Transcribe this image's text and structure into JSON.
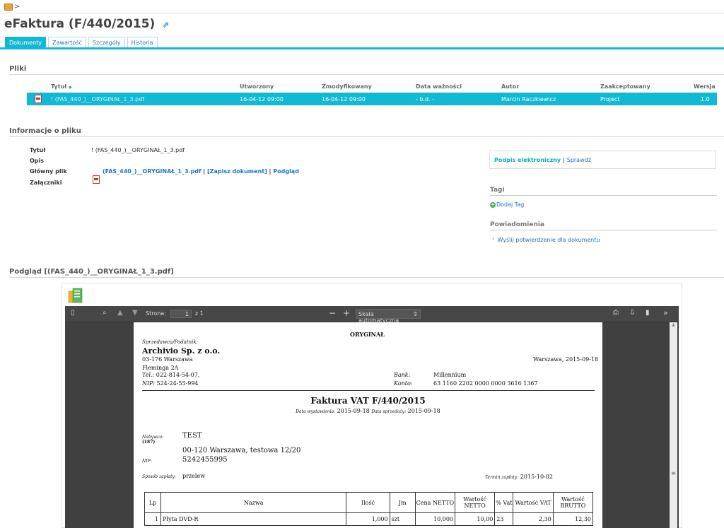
{
  "breadcrumb": {
    "sep": ">"
  },
  "header": {
    "title": "eFaktura (F/440/2015)"
  },
  "tabs": [
    {
      "label": "Dokumenty"
    },
    {
      "label": "Zawartość"
    },
    {
      "label": "Szczegóły"
    },
    {
      "label": "Historia"
    }
  ],
  "files": {
    "section_title": "Pliki",
    "columns": [
      "Tytuł",
      "Utworzony",
      "Zmodyfikowany",
      "Data ważności",
      "Autor",
      "Zaakceptowany",
      "Wersja"
    ],
    "sort_indicator": "◆",
    "row": {
      "title": "! (FAS_440_)__ORYGINAŁ_1_3.pdf",
      "created": "16-04-12 09:00",
      "modified": "16-04-12 09:00",
      "expiry": "- b.d. -",
      "author": "Marcin Raczkiewicz",
      "accepted": "Project",
      "version": "1.0"
    }
  },
  "file_info": {
    "section_title": "Informacje o pliku",
    "title_label": "Tytuł",
    "title_value": "! (FAS_440_)__ORYGINAŁ_1_3.pdf",
    "desc_label": "Opis",
    "main_label": "Główny plik",
    "main_file_link": "(FAS_440_)__ORYGINAŁ_1_3.pdf",
    "sep1": "|",
    "save_link": "[Zapisz dokument]",
    "sep2": "|",
    "preview_link": "Podgląd",
    "attachments_label": "Załączniki"
  },
  "sidebar": {
    "signature_link": "Podpis elektroniczny",
    "sep": "|",
    "verify_link": "Sprawdź",
    "tags_title": "Tagi",
    "add_tag": "Dodaj Tag",
    "notifications_title": "Powiadomienia",
    "send_confirmation": "Wyślij potwierdzenie dla dokumentu"
  },
  "preview": {
    "section_title": "Podgląd [(FAS_440_)__ORYGINAŁ_1_3.pdf]",
    "toolbar": {
      "page_label": "Strona:",
      "page_value": "1",
      "page_total": "z 1",
      "zoom_select": "Skala automatyczna"
    }
  },
  "invoice": {
    "copy_label": "ORYGINAŁ",
    "seller_label": "Sprzedawca/Podatnik:",
    "seller_name": "Archivio Sp. z o.o.",
    "seller_addr1": "03-176 Warszawa",
    "seller_addr2": "Fleminga 2A",
    "tel_label": "Tel.:",
    "tel_value": "022-814-54-07,",
    "nip_label": "NIP:",
    "nip_value": "524-24-55-994",
    "place_date": "Warszawa, 2015-09-18",
    "bank_label": "Bank:",
    "bank_value": "Millennium",
    "account_label": "Konto:",
    "account_value": "63 1160 2202 0000 0000 3616 1367",
    "invoice_title": "Faktura VAT F/440/2015",
    "issue_label": "Data wystawienia:",
    "issue_date": "2015-09-18",
    "sale_label": "Data sprzedaży:",
    "sale_date": "2015-09-18",
    "buyer_label": "Nabywca:",
    "buyer_id": "(187)",
    "buyer_name": "TEST",
    "buyer_addr": "00-120 Warszawa, testowa 12/20",
    "buyer_nip_label": "NIP:",
    "buyer_nip": "5242455995",
    "payment_label": "Sposób zapłaty:",
    "payment_value": "przelew",
    "due_label": "Termin zapłaty:",
    "due_value": "2015-10-02",
    "table_headers": [
      "Lp",
      "Nazwa",
      "Ilość",
      "Jm",
      "Cena NETTO",
      "Wartość NETTO",
      "% Vat",
      "Wartość VAT",
      "Wartość BRUTTO"
    ],
    "items": [
      {
        "lp": "1",
        "name": "Płyta DVD-R",
        "qty": "1,000",
        "unit": "szt",
        "price": "10,000",
        "net": "10,00",
        "vat_rate": "23",
        "vat": "2,30",
        "gross": "12,30"
      }
    ]
  }
}
